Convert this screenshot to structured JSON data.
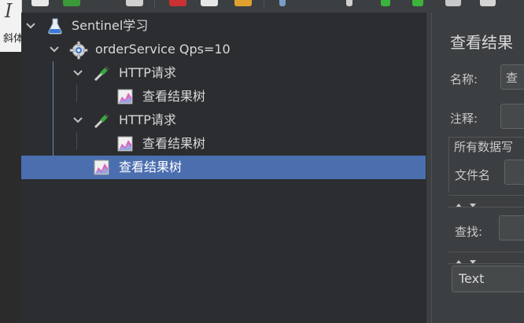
{
  "left_panel": {
    "glyph": "I",
    "text": "斜体"
  },
  "tree": {
    "nodes": [
      {
        "label": "Sentinel学习",
        "icon": "flask-icon",
        "expanded": true,
        "selected": false
      },
      {
        "label": "orderService Qps=10",
        "icon": "gear-icon",
        "expanded": true,
        "selected": false
      },
      {
        "label": "HTTP请求",
        "icon": "pipette-icon",
        "expanded": true,
        "selected": false
      },
      {
        "label": "查看结果树",
        "icon": "result-tree-icon",
        "expanded": false,
        "selected": false
      },
      {
        "label": "HTTP请求",
        "icon": "pipette-icon",
        "expanded": true,
        "selected": false
      },
      {
        "label": "查看结果树",
        "icon": "result-tree-icon",
        "expanded": false,
        "selected": false
      },
      {
        "label": "查看结果树",
        "icon": "result-tree-icon",
        "expanded": false,
        "selected": true
      }
    ]
  },
  "right_panel": {
    "title": "查看结果",
    "name_label": "名称:",
    "name_value": "查",
    "comment_label": "注释:",
    "comment_value": "",
    "all_data_label": "所有数据写",
    "filename_label": "文件名",
    "filename_value": "",
    "search_label": "查找:",
    "search_value": "",
    "renderer_value": "Text"
  },
  "colors": {
    "selection": "#4b6eaf",
    "tree_bg": "#2b2d30",
    "panel_bg": "#3c3f41"
  }
}
